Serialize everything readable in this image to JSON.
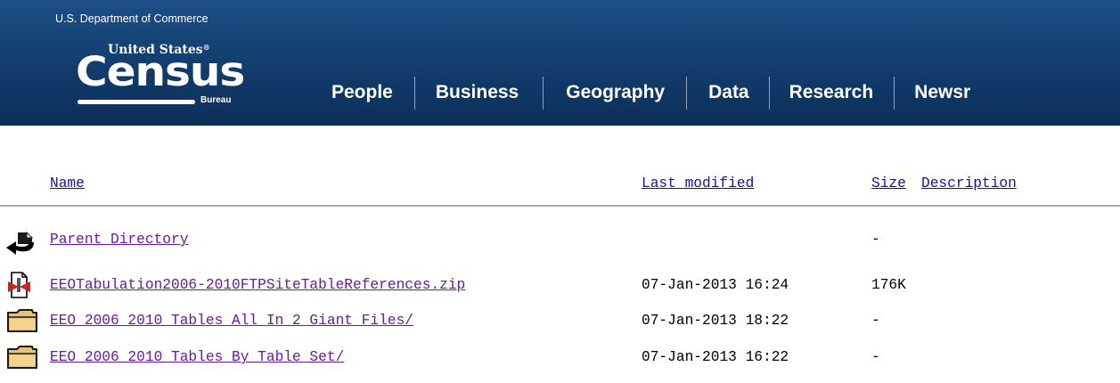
{
  "header": {
    "department": "U.S. Department of Commerce",
    "logo": {
      "line1": "United States",
      "trademark": "®",
      "word": "Census",
      "subword": "Bureau"
    },
    "nav": [
      {
        "label": "People"
      },
      {
        "label": "Business"
      },
      {
        "label": "Geography"
      },
      {
        "label": "Data"
      },
      {
        "label": "Research"
      },
      {
        "label": "Newsr"
      }
    ]
  },
  "listing": {
    "columns": {
      "name": "Name",
      "last_modified": "Last modified",
      "size": "Size",
      "description": "Description"
    },
    "rows": [
      {
        "icon": "back-arrow-icon",
        "name": "Parent Directory",
        "date": "",
        "size": "-"
      },
      {
        "icon": "compressed-file-icon",
        "name": "EEOTabulation2006-2010FTPSiteTableReferences.zip",
        "date": "07-Jan-2013 16:24",
        "size": "176K"
      },
      {
        "icon": "folder-icon",
        "name": "EEO_2006_2010_Tables_All_In_2_Giant_Files/",
        "date": "07-Jan-2013 18:22",
        "size": "-"
      },
      {
        "icon": "folder-icon",
        "name": "EEO_2006_2010_Tables_By_Table_Set/",
        "date": "07-Jan-2013 16:22",
        "size": "-"
      }
    ]
  },
  "colors": {
    "banner": "#123c6d",
    "link": "#1a0dab",
    "visited_link": "#6a1a9a"
  }
}
